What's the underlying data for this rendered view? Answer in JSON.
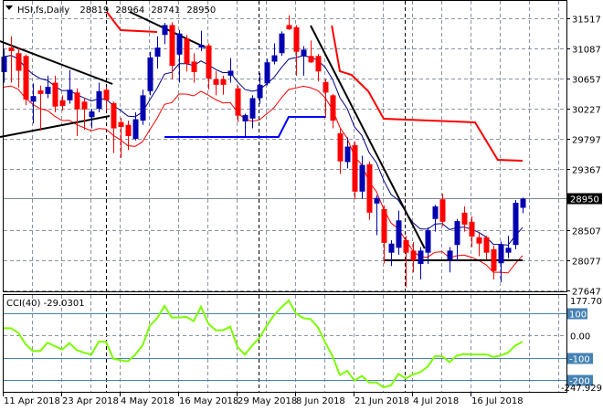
{
  "chart_data": {
    "type": "candlestick",
    "header": {
      "symbol": "HSI,fs,Daily",
      "open": "28819",
      "high": "28964",
      "low": "28741",
      "close": "28950"
    },
    "price_axis": {
      "ticks": [
        "31517",
        "31087",
        "30657",
        "30227",
        "29797",
        "29367",
        "28507",
        "28077",
        "27647"
      ],
      "range": [
        27647,
        31517
      ],
      "current_price_label": "28950"
    },
    "x_axis": {
      "tick_labels": [
        "11 Apr 2018",
        "23 Apr 2018",
        "4 May 2018",
        "16 May 2018",
        "29 May 2018",
        "8 Jun 2018",
        "21 Jun 2018",
        "4 Jul 2018",
        "16 Jul 2018"
      ]
    },
    "grid": true,
    "colors": {
      "bull": "#0000b0",
      "bear": "#ff0000",
      "ma_fast": "#000080",
      "ma_lower": "#ff0000",
      "cci": "#7cfc00",
      "cci_levels": "#4682b4",
      "trendline": "#000000"
    },
    "candles_ohlc": [
      [
        30750,
        31080,
        30600,
        30970
      ],
      [
        31100,
        31260,
        30600,
        31050
      ],
      [
        31020,
        31100,
        30530,
        30770
      ],
      [
        30980,
        31000,
        30280,
        30360
      ],
      [
        30330,
        30590,
        30020,
        30410
      ],
      [
        30490,
        30560,
        29920,
        30440
      ],
      [
        30440,
        30700,
        30380,
        30540
      ],
      [
        30600,
        30700,
        30180,
        30260
      ],
      [
        30350,
        30420,
        30200,
        30270
      ],
      [
        30350,
        30780,
        30300,
        30500
      ],
      [
        30460,
        30520,
        29840,
        30220
      ],
      [
        30330,
        30380,
        29930,
        30220
      ],
      [
        30110,
        30230,
        29950,
        30190
      ],
      [
        30230,
        30600,
        30180,
        30480
      ],
      [
        30500,
        30540,
        30200,
        30350
      ],
      [
        30310,
        30330,
        29600,
        29950
      ],
      [
        30040,
        30100,
        29530,
        29970
      ],
      [
        30000,
        30060,
        29640,
        29840
      ],
      [
        29800,
        30180,
        29780,
        30080
      ],
      [
        30060,
        30500,
        30000,
        30420
      ],
      [
        30480,
        31040,
        30420,
        30960
      ],
      [
        30970,
        31260,
        30800,
        31100
      ],
      [
        31280,
        31450,
        31150,
        31420
      ],
      [
        31420,
        31460,
        30650,
        30840
      ],
      [
        31000,
        31350,
        30600,
        31300
      ],
      [
        31230,
        31280,
        30760,
        30870
      ],
      [
        30900,
        31020,
        30600,
        30750
      ],
      [
        31100,
        31340,
        31050,
        31140
      ],
      [
        31130,
        31160,
        30500,
        30660
      ],
      [
        30650,
        30770,
        30420,
        30570
      ],
      [
        30650,
        30700,
        30430,
        30570
      ],
      [
        30700,
        30950,
        30600,
        30770
      ],
      [
        30520,
        30560,
        30040,
        30130
      ],
      [
        30050,
        30160,
        29820,
        30140
      ],
      [
        30090,
        30420,
        29950,
        30380
      ],
      [
        30380,
        30740,
        30300,
        30570
      ],
      [
        30590,
        30940,
        30560,
        30890
      ],
      [
        30900,
        31160,
        30860,
        30990
      ],
      [
        31020,
        31330,
        30980,
        31300
      ],
      [
        31420,
        31560,
        31350,
        31360
      ],
      [
        31390,
        31420,
        30700,
        31040
      ],
      [
        30980,
        31120,
        30700,
        31070
      ],
      [
        30980,
        31200,
        30880,
        30890
      ],
      [
        30980,
        31010,
        30620,
        30760
      ],
      [
        30610,
        30650,
        30100,
        30460
      ],
      [
        30420,
        30440,
        29950,
        30060
      ],
      [
        29880,
        29950,
        29300,
        29480
      ],
      [
        29470,
        29820,
        29380,
        29690
      ],
      [
        29710,
        29760,
        28950,
        29050
      ],
      [
        29050,
        29560,
        28950,
        29430
      ],
      [
        29440,
        29480,
        28650,
        28750
      ],
      [
        28880,
        29000,
        28430,
        28960
      ],
      [
        28800,
        28850,
        28030,
        28320
      ],
      [
        28180,
        28360,
        27990,
        28310
      ],
      [
        28250,
        28780,
        28150,
        28640
      ],
      [
        28360,
        28420,
        27690,
        28180
      ],
      [
        28210,
        28330,
        27900,
        28070
      ],
      [
        28020,
        28260,
        27800,
        28210
      ],
      [
        28180,
        28540,
        28020,
        28500
      ],
      [
        28660,
        28860,
        28480,
        28840
      ],
      [
        28940,
        29020,
        28560,
        28620
      ],
      [
        28080,
        28260,
        27900,
        28210
      ],
      [
        28290,
        28660,
        28060,
        28630
      ],
      [
        28750,
        28840,
        28480,
        28580
      ],
      [
        28620,
        28700,
        28260,
        28410
      ],
      [
        28400,
        28460,
        28130,
        28310
      ],
      [
        28400,
        28420,
        28080,
        28180
      ],
      [
        28230,
        28280,
        27800,
        27920
      ],
      [
        28030,
        28340,
        27760,
        28300
      ],
      [
        28180,
        28420,
        28100,
        28250
      ],
      [
        28290,
        28930,
        28230,
        28890
      ],
      [
        28819,
        28964,
        28741,
        28950
      ]
    ],
    "upper_stop_line": [
      [
        [
          14.1,
          31608
        ],
        [
          16,
          31348
        ],
        [
          21,
          31322
        ]
      ],
      [
        [
          44.9,
          31413
        ],
        [
          46,
          30763
        ],
        [
          47.6,
          30711
        ],
        [
          49.9,
          30477
        ],
        [
          52,
          30087
        ],
        [
          64.5,
          30035
        ],
        [
          67.6,
          29502
        ],
        [
          71,
          29489
        ]
      ]
    ],
    "lower_stop_line": [
      [
        22,
        29827
      ],
      [
        37.6,
        29827
      ],
      [
        39,
        30113
      ],
      [
        44,
        30113
      ]
    ],
    "trendlines": [
      [
        [
          -0.5,
          31192
        ],
        [
          14.9,
          30581
        ]
      ],
      [
        [
          -0.5,
          29827
        ],
        [
          14.5,
          30126
        ]
      ],
      [
        [
          17.25,
          31608
        ],
        [
          27.6,
          31101
        ]
      ],
      [
        [
          42,
          31413
        ],
        [
          57.6,
          28241
        ]
      ],
      [
        [
          52,
          28072
        ],
        [
          71,
          28072
        ]
      ]
    ],
    "cci": {
      "label": "CCI(40) -29.0301",
      "scale_max_label": "177.7073",
      "scale_min_label": "-247.929",
      "levels": [
        "100",
        "0.00",
        "-100",
        "-200"
      ],
      "values": [
        31,
        31,
        11,
        -40,
        -71,
        -71,
        -33,
        -49,
        -64,
        -35,
        -67,
        -78,
        -87,
        -29,
        -29,
        -105,
        -112,
        -117,
        -87,
        -46,
        42,
        76,
        131,
        79,
        79,
        82,
        63,
        127,
        52,
        22,
        22,
        38,
        -53,
        -87,
        -46,
        -12,
        42,
        90,
        124,
        155,
        97,
        76,
        72,
        35,
        -33,
        -94,
        -178,
        -159,
        -203,
        -182,
        -211,
        -211,
        -233,
        -224,
        -173,
        -193,
        -176,
        -165,
        -141,
        -94,
        -94,
        -121,
        -91,
        -84,
        -86,
        -86,
        -86,
        -97,
        -91,
        -78,
        -46,
        -29.03
      ]
    }
  }
}
